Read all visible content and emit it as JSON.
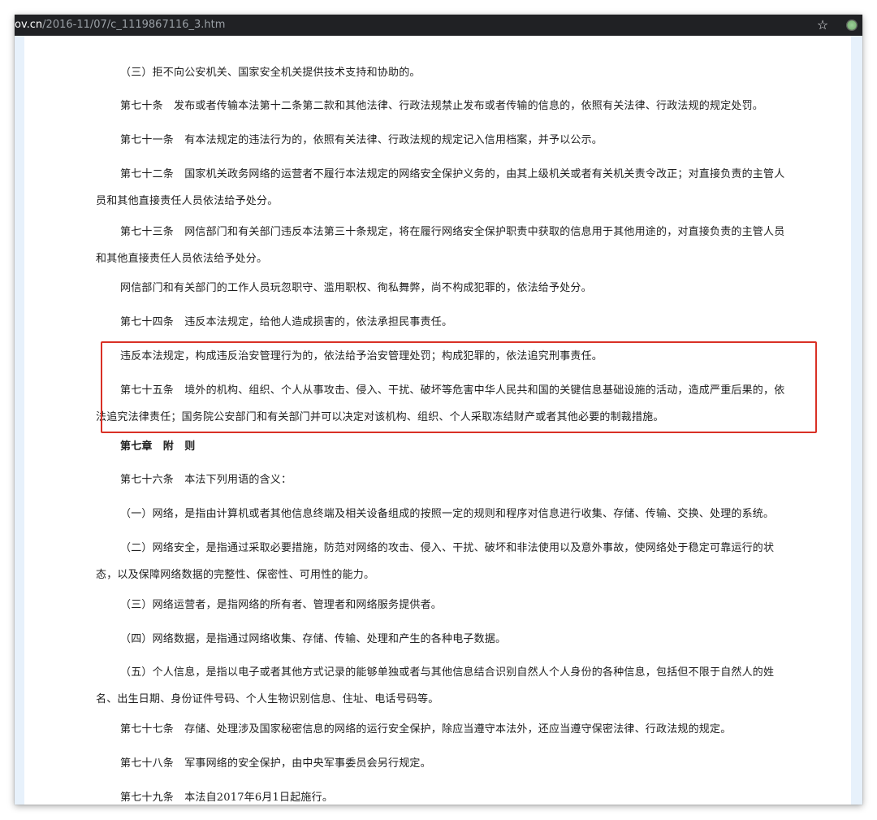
{
  "browser": {
    "url_host": "ov.cn",
    "url_path": "/2016-11/07/c_1119867116_3.htm",
    "bookmark_icon": "star-icon",
    "extension_icon": "extension-icon"
  },
  "highlight": {
    "color": "#d93025"
  },
  "paragraphs": [
    "（三）拒不向公安机关、国家安全机关提供技术支持和协助的。",
    "第七十条　发布或者传输本法第十二条第二款和其他法律、行政法规禁止发布或者传输的信息的，依照有关法律、行政法规的规定处罚。",
    "第七十一条　有本法规定的违法行为的，依照有关法律、行政法规的规定记入信用档案，并予以公示。",
    "第七十二条　国家机关政务网络的运营者不履行本法规定的网络安全保护义务的，由其上级机关或者有关机关责令改正；对直接负责的主管人员和其他直接责任人员依法给予处分。",
    "第七十三条　网信部门和有关部门违反本法第三十条规定，将在履行网络安全保护职责中获取的信息用于其他用途的，对直接负责的主管人员和其他直接责任人员依法给予处分。",
    "网信部门和有关部门的工作人员玩忽职守、滥用职权、徇私舞弊，尚不构成犯罪的，依法给予处分。",
    "第七十四条　违反本法规定，给他人造成损害的，依法承担民事责任。",
    "违反本法规定，构成违反治安管理行为的，依法给予治安管理处罚；构成犯罪的，依法追究刑事责任。",
    "第七十五条　境外的机构、组织、个人从事攻击、侵入、干扰、破坏等危害中华人民共和国的关键信息基础设施的活动，造成严重后果的，依法追究法律责任；国务院公安部门和有关部门并可以决定对该机构、组织、个人采取冻结财产或者其他必要的制裁措施。",
    "第七章　附　则",
    "第七十六条　本法下列用语的含义：",
    "（一）网络，是指由计算机或者其他信息终端及相关设备组成的按照一定的规则和程序对信息进行收集、存储、传输、交换、处理的系统。",
    "（二）网络安全，是指通过采取必要措施，防范对网络的攻击、侵入、干扰、破坏和非法使用以及意外事故，使网络处于稳定可靠运行的状态，以及保障网络数据的完整性、保密性、可用性的能力。",
    "（三）网络运营者，是指网络的所有者、管理者和网络服务提供者。",
    "（四）网络数据，是指通过网络收集、存储、传输、处理和产生的各种电子数据。",
    "（五）个人信息，是指以电子或者其他方式记录的能够单独或者与其他信息结合识别自然人个人身份的各种信息，包括但不限于自然人的姓名、出生日期、身份证件号码、个人生物识别信息、住址、电话号码等。",
    "第七十七条　存储、处理涉及国家秘密信息的网络的运行安全保护，除应当遵守本法外，还应当遵守保密法律、行政法规的规定。",
    "第七十八条　军事网络的安全保护，由中央军事委员会另行规定。",
    "第七十九条　本法自2017年6月1日起施行。"
  ]
}
